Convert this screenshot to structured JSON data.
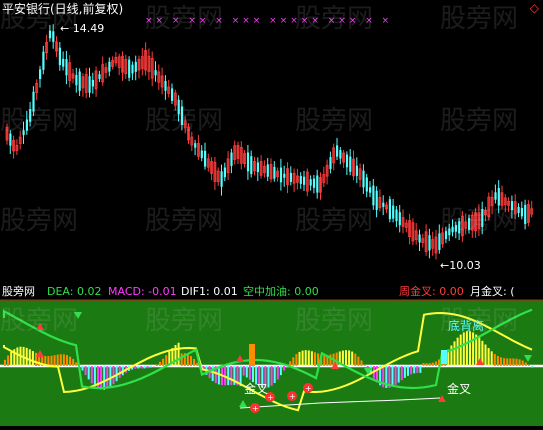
{
  "price_panel": {
    "title": "平安银行(日线,前复权)",
    "high_label": "14.49",
    "low_label": "10.03",
    "cross_marks": "×× × ×× × ××× ××××× ××× × ×"
  },
  "indicator_bar": {
    "name": "股旁网",
    "dea": "DEA: 0.02",
    "macd": "MACD: -0.01",
    "dif1": "DIF1: 0.01",
    "kongzhong": "空中加油: 0.00",
    "zhoujincha": "周金叉: 0.00",
    "yuejincha": "月金叉: ("
  },
  "annotations": {
    "di_bei_li": "底背离",
    "jin_cha_1": "金叉",
    "jin_cha_2": "金叉"
  },
  "watermark": "股旁网",
  "colors": {
    "up": "#ff3b3b",
    "down": "#54ffff",
    "green_band": "#1c7a12",
    "yellow": "#ffff3c",
    "green_line": "#2ee04a",
    "magenta": "#ff3cff",
    "orange": "#ff8c00"
  }
}
